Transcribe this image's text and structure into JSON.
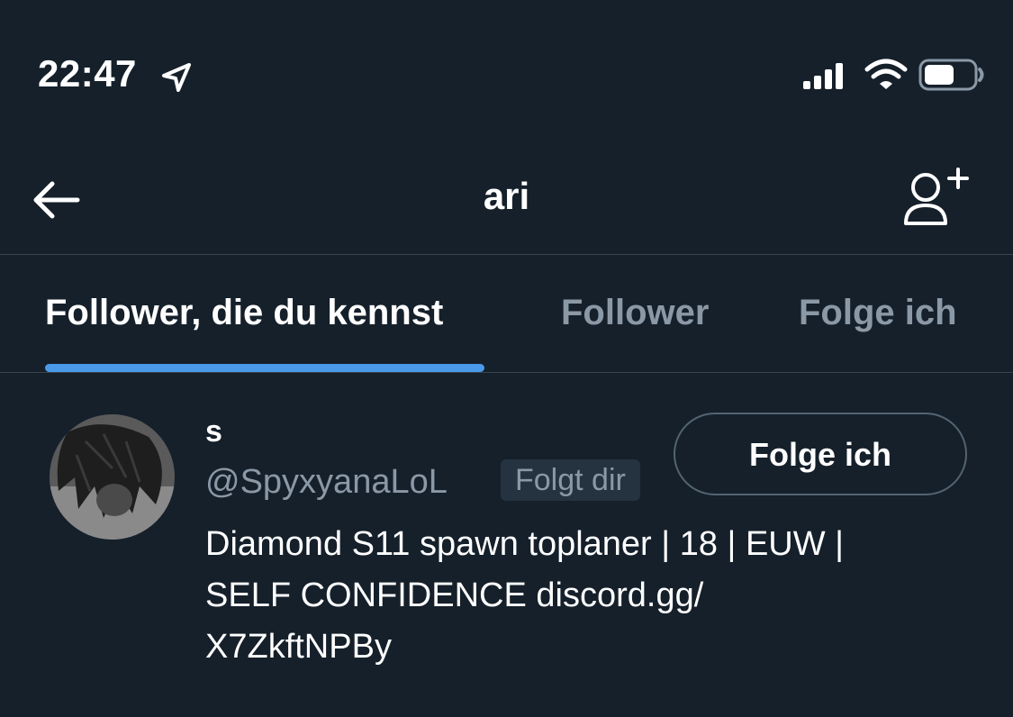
{
  "status_bar": {
    "time": "22:47",
    "icons": [
      "location-arrow-icon",
      "cellular-signal-icon",
      "wifi-icon",
      "battery-icon"
    ]
  },
  "nav": {
    "title": "ari",
    "back_icon": "back-arrow-icon",
    "add_user_icon": "add-user-icon"
  },
  "tabs": [
    {
      "label": "Follower, die du kennst",
      "active": true
    },
    {
      "label": "Follower",
      "active": false
    },
    {
      "label": "Folge ich",
      "active": false
    }
  ],
  "user": {
    "display_name": "s",
    "handle": "@SpyxyanaLoL",
    "follows_you_badge": "Folgt dir",
    "follow_button_label": "Folge ich",
    "bio_line1": "Diamond S11 spawn toplaner | 18 | EUW |",
    "bio_line2_text": "SELF CONFIDENCE ",
    "bio_link_part1": "discord.gg/",
    "bio_link_part2": "X7ZkftNPBy"
  },
  "colors": {
    "background": "#15202b",
    "accent": "#4a9ae9",
    "secondary_text": "#8b98a5",
    "divider": "#38444d"
  }
}
